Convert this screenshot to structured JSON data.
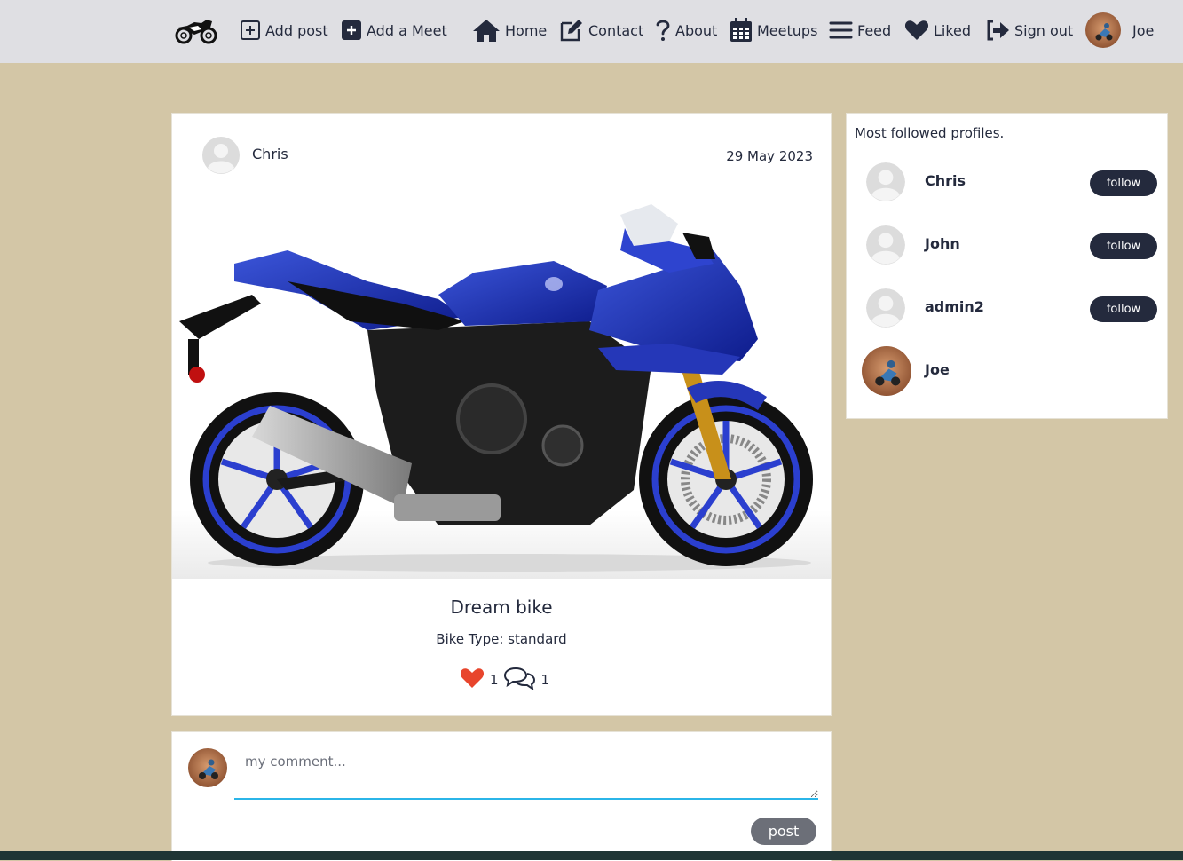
{
  "navbar": {
    "logo_icon": "motorcycle-icon",
    "items": [
      {
        "label": "Add post",
        "icon": "plus-square-icon"
      },
      {
        "label": "Add a Meet",
        "icon": "plus-square-filled-icon"
      },
      {
        "label": "Home",
        "icon": "home-icon"
      },
      {
        "label": "Contact",
        "icon": "edit-icon"
      },
      {
        "label": "About",
        "icon": "question-icon"
      },
      {
        "label": "Meetups",
        "icon": "calendar-icon"
      },
      {
        "label": "Feed",
        "icon": "feed-lines-icon"
      },
      {
        "label": "Liked",
        "icon": "heart-icon"
      },
      {
        "label": "Sign out",
        "icon": "sign-out-icon"
      }
    ],
    "user": {
      "name": "Joe"
    }
  },
  "post": {
    "owner": "Chris",
    "date": "29 May 2023",
    "title": "Dream bike",
    "bike_type": "Bike Type: standard",
    "likes_count": "1",
    "comments_count": "1"
  },
  "comment_form": {
    "placeholder": "my comment...",
    "submit_label": "post"
  },
  "sidebar": {
    "title": "Most followed profiles.",
    "profiles": [
      {
        "name": "Chris",
        "follow_label": "follow"
      },
      {
        "name": "John",
        "follow_label": "follow"
      },
      {
        "name": "admin2",
        "follow_label": "follow"
      },
      {
        "name": "Joe"
      }
    ]
  },
  "colors": {
    "page_background": "#d3c6a6",
    "navbar_background": "#dfdfe3",
    "primary_dark": "#242a3d",
    "like_red": "#e8452c",
    "input_underline": "#2bb5e8",
    "post_button": "#6c6f78"
  }
}
